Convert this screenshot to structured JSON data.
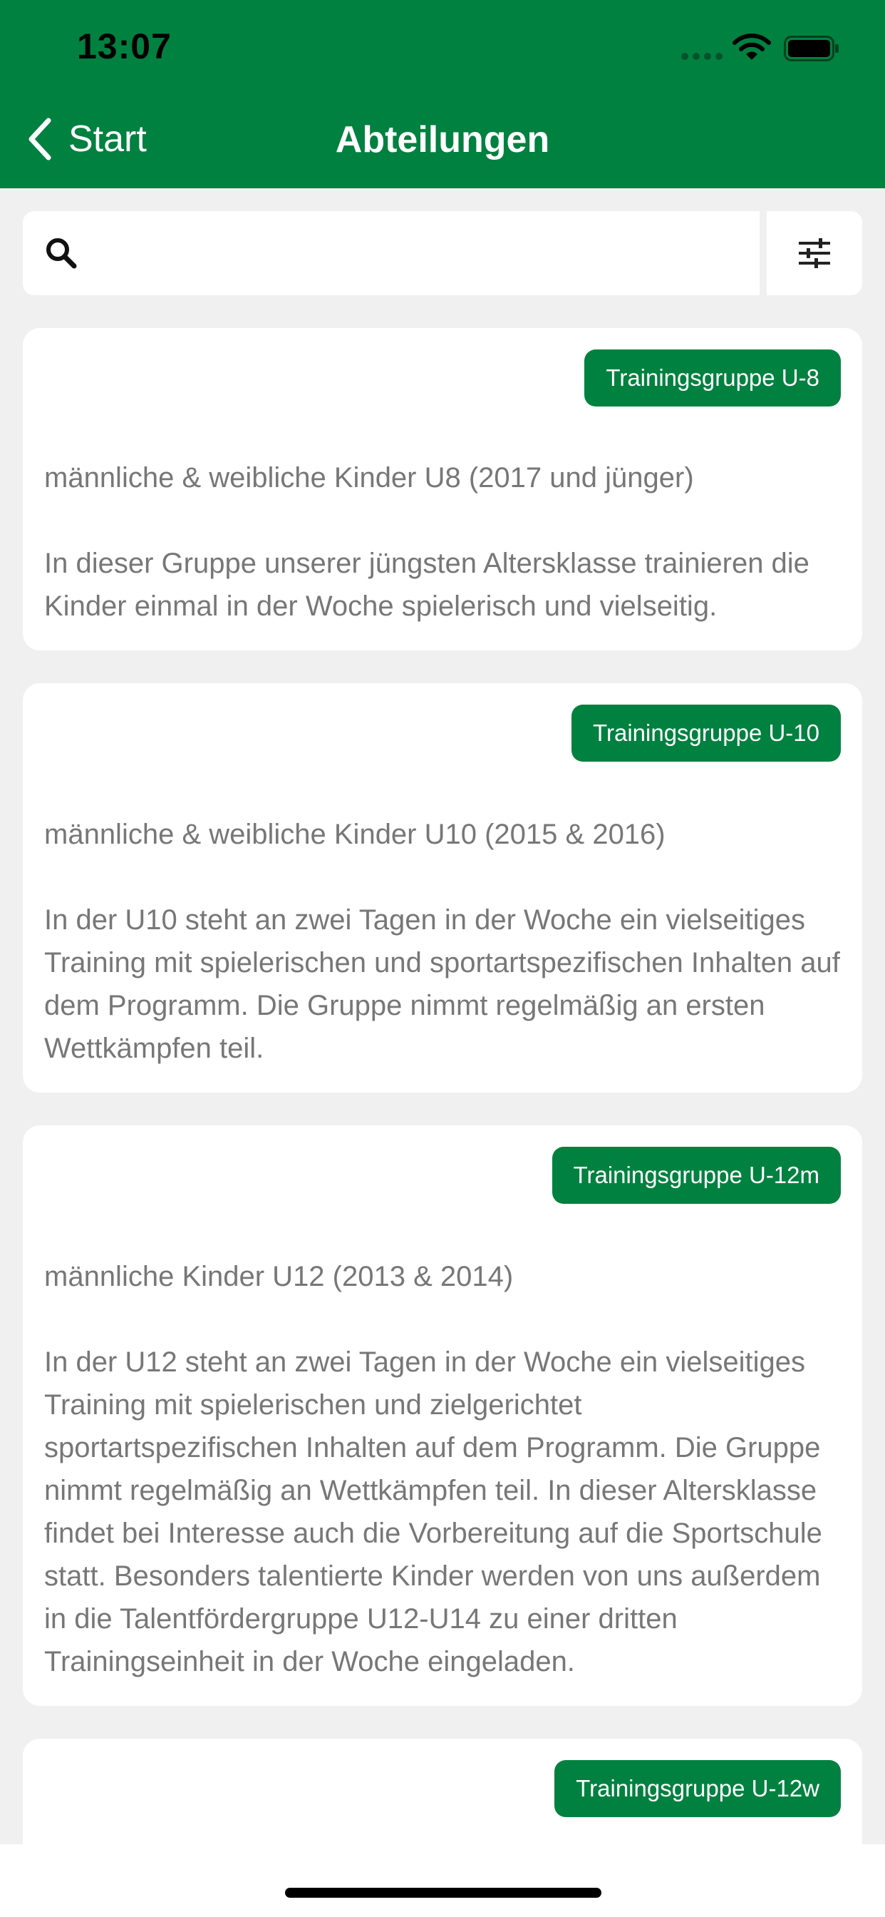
{
  "status_bar": {
    "time": "13:07"
  },
  "nav": {
    "back_label": "Start",
    "title": "Abteilungen"
  },
  "search": {
    "value": "",
    "placeholder": ""
  },
  "cards": [
    {
      "badge": "Trainingsgruppe U-8",
      "subtitle": "männliche & weibliche Kinder U8 (2017 und jünger)",
      "description": "In dieser Gruppe unserer jüngsten Altersklasse trainieren die Kinder einmal in der Woche spielerisch und vielseitig."
    },
    {
      "badge": "Trainingsgruppe U-10",
      "subtitle": "männliche & weibliche Kinder U10 (2015 & 2016)",
      "description": "In der U10 steht an zwei Tagen in der Woche ein vielseitiges Training mit spielerischen und sportartspezifischen Inhalten auf dem Programm. Die Gruppe nimmt regelmäßig an ersten Wettkämpfen teil."
    },
    {
      "badge": "Trainingsgruppe U-12m",
      "subtitle": "männliche Kinder U12 (2013 & 2014)",
      "description": "In der U12 steht an zwei Tagen in der Woche ein vielseitiges Training mit spielerischen und zielgerichtet sportartspezifischen Inhalten auf dem Programm. Die Gruppe nimmt regelmäßig an Wettkämpfen teil. In dieser Altersklasse findet bei Interesse auch die Vorbereitung auf die Sportschule statt. Besonders talentierte Kinder werden von uns außerdem in die Talentfördergruppe U12-U14 zu einer dritten Trainingseinheit in der Woche eingeladen."
    },
    {
      "badge": "Trainingsgruppe U-12w",
      "subtitle": "",
      "description": ""
    }
  ],
  "colors": {
    "primary": "#008140",
    "background": "#f0f0f0",
    "text_muted": "#777777"
  }
}
